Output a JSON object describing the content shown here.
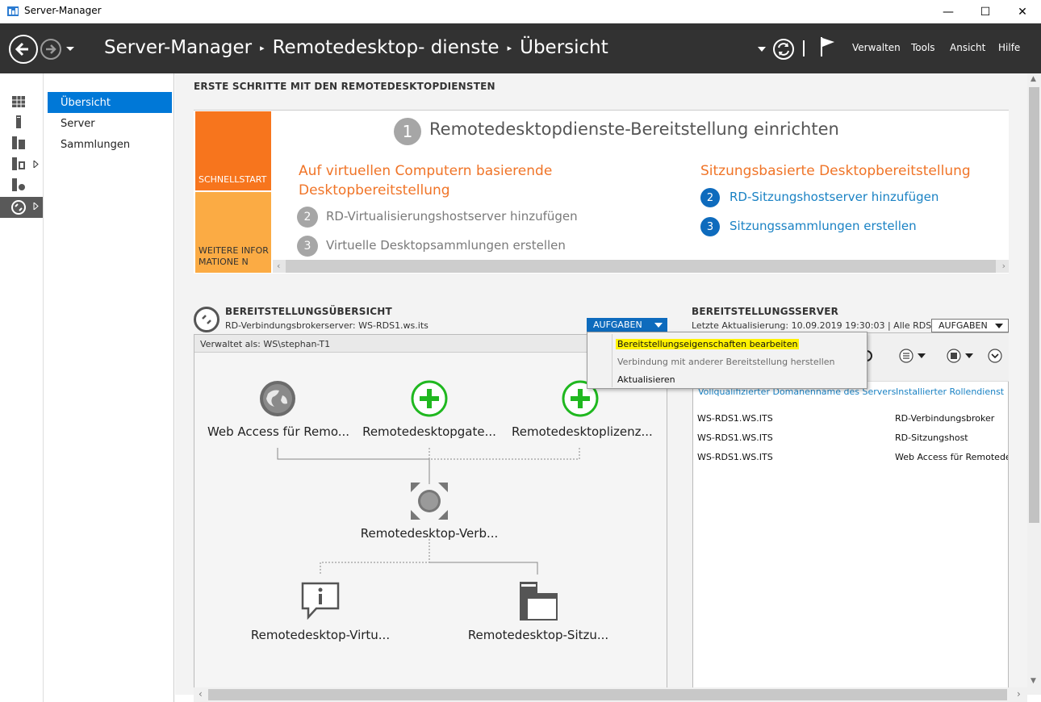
{
  "window": {
    "title": "Server-Manager",
    "minimize": "—",
    "maximize": "☐",
    "close": "✕"
  },
  "header": {
    "breadcrumb": [
      "Server-Manager",
      "Remotedesktop- dienste",
      "Übersicht"
    ],
    "separator": "▸",
    "menu": [
      "Verwalten",
      "Tools",
      "Ansicht",
      "Hilfe"
    ]
  },
  "nav": {
    "items": [
      "Übersicht",
      "Server",
      "Sammlungen"
    ],
    "selected": "Übersicht"
  },
  "quickstart": {
    "heading": "ERSTE SCHRITTE MIT DEN REMOTEDESKTOPDIENSTEN",
    "tab1": "SCHNELLSTART",
    "tab2": "WEITERE INFORMATIONE N",
    "step1_num": "1",
    "step1_text": "Remotedesktopdienste-Bereitstellung einrichten",
    "left_title": "Auf virtuellen Computern basierende Desktopbereitstellung",
    "left_steps": [
      {
        "num": "2",
        "text": "RD-Virtualisierungshostserver hinzufügen"
      },
      {
        "num": "3",
        "text": "Virtuelle Desktopsammlungen erstellen"
      }
    ],
    "right_title": "Sitzungsbasierte Desktopbereitstellung",
    "right_steps": [
      {
        "num": "2",
        "text": "RD-Sitzungshostserver hinzufügen"
      },
      {
        "num": "3",
        "text": "Sitzungssammlungen erstellen"
      }
    ]
  },
  "overview": {
    "heading": "BEREITSTELLUNGSÜBERSICHT",
    "subtitle": "RD-Verbindungsbrokerserver: WS-RDS1.ws.its",
    "tasks_label": "AUFGABEN",
    "managed_as": "Verwaltet als: WS\\stephan-T1",
    "roles": {
      "web_access": "Web Access für Remo...",
      "gateway": "Remotedesktopgate...",
      "licensing": "Remotedesktoplizenz...",
      "broker": "Remotedesktop-Verb...",
      "virtualization": "Remotedesktop-Virtu...",
      "session_host": "Remotedesktop-Sitzu..."
    }
  },
  "servers": {
    "heading": "BEREITSTELLUNGSSERVER",
    "last_update": "Letzte Aktualisierung: 10.09.2019 19:30:03 | Alle RDS-...",
    "tasks_label": "AUFGABEN",
    "columns": [
      "Vollqualifizierter Domänenname des Servers",
      "Installierter Rollendienst"
    ],
    "rows": [
      {
        "fqdn": "WS-RDS1.WS.ITS",
        "role": "RD-Verbindungsbroker"
      },
      {
        "fqdn": "WS-RDS1.WS.ITS",
        "role": "RD-Sitzungshost"
      },
      {
        "fqdn": "WS-RDS1.WS.ITS",
        "role": "Web Access für Remotedes"
      }
    ]
  },
  "dropdown": {
    "items": [
      {
        "label": "Bereitstellungseigenschaften bearbeiten",
        "highlighted": true
      },
      {
        "label": "Verbindung mit anderer Bereitstellung herstellen",
        "disabled": true
      },
      {
        "label": "Aktualisieren"
      }
    ]
  },
  "colors": {
    "accent": "#0078d7",
    "header_bg": "#323232",
    "quickstart_orange": "#f7751d",
    "learn_more_orange": "#fbab44",
    "highlight_yellow": "#fff200",
    "add_green": "#20b820"
  }
}
